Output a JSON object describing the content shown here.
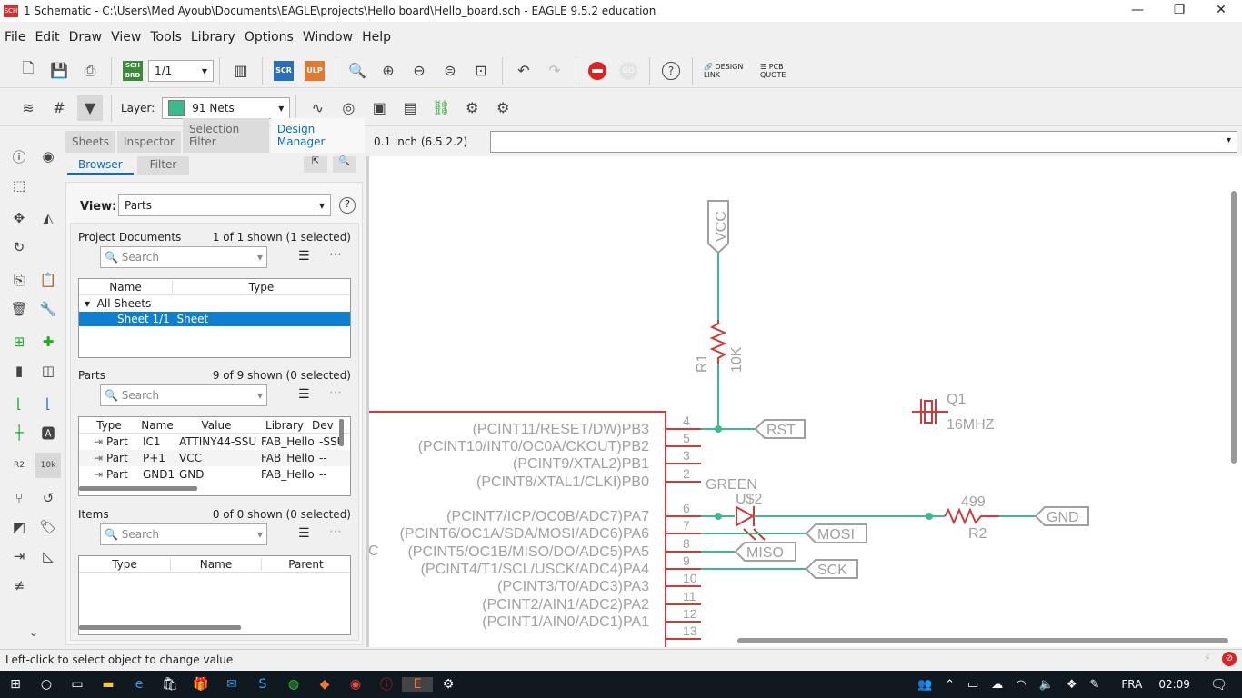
{
  "window": {
    "title": "1 Schematic - C:\\Users\\Med Ayoub\\Documents\\EAGLE\\projects\\Hello board\\Hello_board.sch - EAGLE 9.5.2 education",
    "icon_text": "SCH"
  },
  "menu": [
    "File",
    "Edit",
    "Draw",
    "View",
    "Tools",
    "Library",
    "Options",
    "Window",
    "Help"
  ],
  "toolbar": {
    "sheet_select": "1/1",
    "scr": "SCR",
    "ulp": "ULP",
    "sch": "SCH",
    "brd": "BRD",
    "go": "GO",
    "design_link": "DESIGN LINK",
    "pcb_quote": "PCB QUOTE",
    "help": "?"
  },
  "toolbar2": {
    "layer_label": "Layer:",
    "layer_value": "91 Nets",
    "layer_color": "#3dba8c"
  },
  "panel": {
    "tabs": [
      "Sheets",
      "Inspector",
      "Selection Filter",
      "Design Manager"
    ],
    "active_tab": "Design Manager",
    "subtabs": [
      "Browser",
      "Filter"
    ],
    "view_label": "View:",
    "view_value": "Parts",
    "project": {
      "title": "Project Documents",
      "count": "1 of 1 shown (1 selected)",
      "search": "Search",
      "columns": [
        "Name",
        "Type"
      ],
      "tree_root": "All Sheets",
      "selected_row": {
        "name": "Sheet 1/1",
        "type": "Sheet"
      }
    },
    "parts": {
      "title": "Parts",
      "count": "9 of 9 shown (0 selected)",
      "search": "Search",
      "columns": [
        "Type",
        "Name",
        "Value",
        "Library",
        "Dev"
      ],
      "rows": [
        {
          "type": "Part",
          "name": "IC1",
          "value": "ATTINY44-SSU",
          "library": "FAB_Hello",
          "dev": "-SSU"
        },
        {
          "type": "Part",
          "name": "P+1",
          "value": "VCC",
          "library": "FAB_Hello",
          "dev": "--"
        },
        {
          "type": "Part",
          "name": "GND1",
          "value": "GND",
          "library": "FAB_Hello",
          "dev": "--"
        }
      ]
    },
    "items": {
      "title": "Items",
      "count": "0 of 0 shown (0 selected)",
      "search": "Search",
      "columns": [
        "Type",
        "Name",
        "Parent"
      ]
    }
  },
  "command": {
    "coords": "0.1 inch (6.5 2.2)",
    "input": ""
  },
  "schematic": {
    "pins_left": [
      {
        "label": "(PCINT11/RESET/DW)PB3",
        "num": "4"
      },
      {
        "label": "(PCINT10/INT0/OC0A/CKOUT)PB2",
        "num": "5"
      },
      {
        "label": "(PCINT9/XTAL2)PB1",
        "num": "3"
      },
      {
        "label": "(PCINT8/XTAL1/CLKI)PB0",
        "num": "2"
      },
      {
        "label": "(PCINT7/ICP/OC0B/ADC7)PA7",
        "num": "6"
      },
      {
        "label": "(PCINT6/OC1A/SDA/MOSI/ADC6)PA6",
        "num": "7"
      },
      {
        "label": "(PCINT5/OC1B/MISO/DO/ADC5)PA5",
        "num": "8"
      },
      {
        "label": "(PCINT4/T1/SCL/USCK/ADC4)PA4",
        "num": "9"
      },
      {
        "label": "(PCINT3/T0/ADC3)PA3",
        "num": "10"
      },
      {
        "label": "(PCINT2/AIN1/ADC2)PA2",
        "num": "11"
      },
      {
        "label": "(PCINT1/AIN0/ADC1)PA1",
        "num": "12"
      },
      {
        "label": "",
        "num": "13"
      }
    ],
    "ic_partial_label": "C",
    "vcc": "VCC",
    "r1_name": "R1",
    "r1_value": "10K",
    "q1_name": "Q1",
    "q1_value": "16MHZ",
    "led_name": "U$2",
    "led_value": "GREEN",
    "r2_name": "R2",
    "r2_value": "499",
    "labels": {
      "rst": "RST",
      "mosi": "MOSI",
      "miso": "MISO",
      "sck": "SCK",
      "gnd": "GND"
    },
    "colors": {
      "net": "#3dba8c",
      "part": "#d03a3a",
      "text": "#a0a0a0"
    }
  },
  "status": "Left-click to select object to change value",
  "taskbar": {
    "lang": "FRA",
    "time": "02:09"
  }
}
